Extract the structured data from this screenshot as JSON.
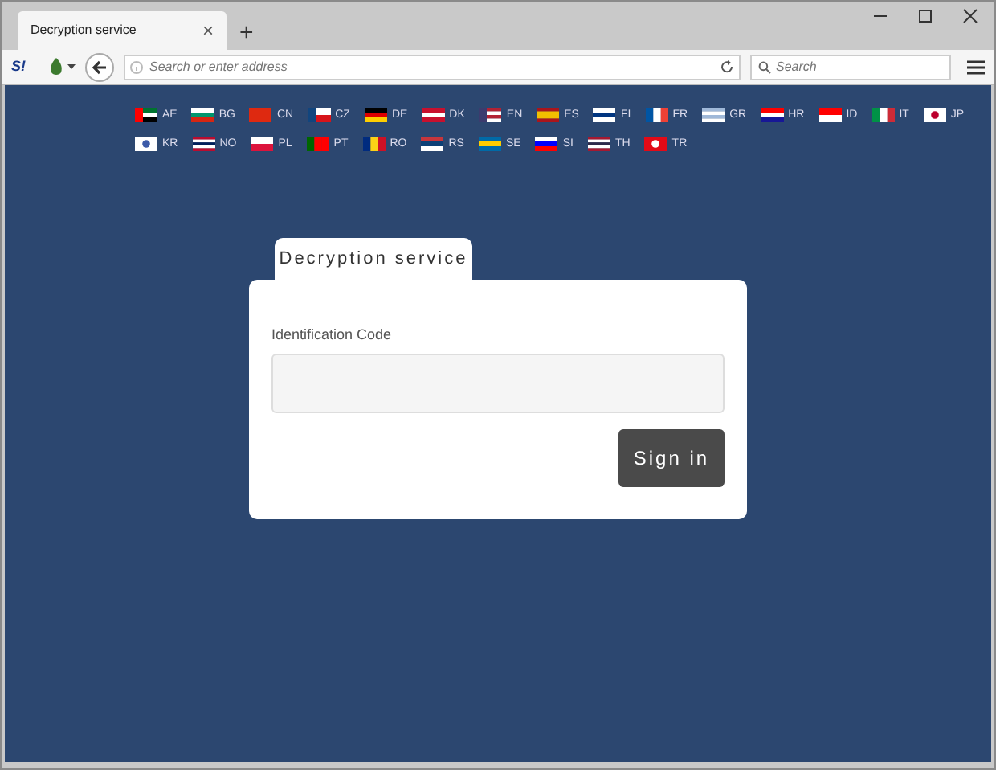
{
  "browser": {
    "tab": {
      "title": "Decryption service",
      "close": "×"
    },
    "new_tab": "+",
    "address": {
      "placeholder": "Search or enter address"
    },
    "search": {
      "placeholder": "Search"
    },
    "addon_label": "S!"
  },
  "languages": [
    {
      "code": "AE"
    },
    {
      "code": "BG"
    },
    {
      "code": "CN"
    },
    {
      "code": "CZ"
    },
    {
      "code": "DE"
    },
    {
      "code": "DK"
    },
    {
      "code": "EN"
    },
    {
      "code": "ES"
    },
    {
      "code": "FI"
    },
    {
      "code": "FR"
    },
    {
      "code": "GR"
    },
    {
      "code": "HR"
    },
    {
      "code": "ID"
    },
    {
      "code": "IT"
    },
    {
      "code": "JP"
    },
    {
      "code": "KR"
    },
    {
      "code": "NO"
    },
    {
      "code": "PL"
    },
    {
      "code": "PT"
    },
    {
      "code": "RO"
    },
    {
      "code": "RS"
    },
    {
      "code": "SE"
    },
    {
      "code": "SI"
    },
    {
      "code": "TH"
    },
    {
      "code": "TR"
    }
  ],
  "login": {
    "tab": "Decryption service",
    "field_label": "Identification Code",
    "button": "Sign in"
  }
}
